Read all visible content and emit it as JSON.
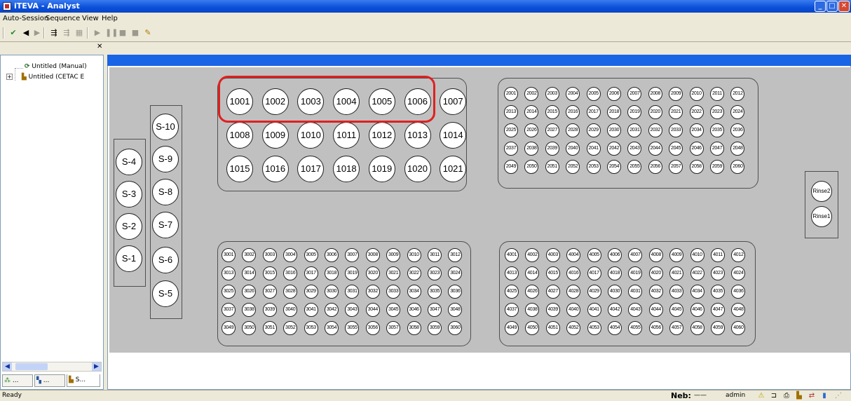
{
  "window": {
    "title": "iTEVA - Analyst"
  },
  "menu": [
    "Auto-Session",
    "Sequence",
    "View",
    "Help"
  ],
  "tree": {
    "items": [
      "Untitled (Manual)",
      "Untitled (CETAC E"
    ]
  },
  "left_tabs": [
    "...",
    "...",
    "S..."
  ],
  "standards_left": [
    "S-4",
    "S-3",
    "S-2",
    "S-1"
  ],
  "standards_right": [
    "S-10",
    "S-9",
    "S-8",
    "S-7",
    "S-6",
    "S-5"
  ],
  "rack1000": [
    [
      "1001",
      "1002",
      "1003",
      "1004",
      "1005",
      "1006",
      "1007"
    ],
    [
      "1008",
      "1009",
      "1010",
      "1011",
      "1012",
      "1013",
      "1014"
    ],
    [
      "1015",
      "1016",
      "1017",
      "1018",
      "1019",
      "1020",
      "1021"
    ]
  ],
  "rack2000": [
    [
      "2001",
      "2002",
      "2003",
      "2004",
      "2005",
      "2006",
      "2007",
      "2008",
      "2009",
      "2010",
      "2011",
      "2012"
    ],
    [
      "2013",
      "2014",
      "2015",
      "2016",
      "2017",
      "2018",
      "2019",
      "2020",
      "2021",
      "2022",
      "2023",
      "2024"
    ],
    [
      "2025",
      "2026",
      "2027",
      "2028",
      "2029",
      "2030",
      "2031",
      "2032",
      "2033",
      "2034",
      "2035",
      "2036"
    ],
    [
      "2037",
      "2038",
      "2039",
      "2040",
      "2041",
      "2042",
      "2043",
      "2044",
      "2045",
      "2046",
      "2047",
      "2048"
    ],
    [
      "2049",
      "2050",
      "2051",
      "2052",
      "2053",
      "2054",
      "2055",
      "2056",
      "2057",
      "2058",
      "2059",
      "2060"
    ]
  ],
  "rack3000": [
    [
      "3001",
      "3002",
      "3003",
      "3004",
      "3005",
      "3006",
      "3007",
      "3008",
      "3009",
      "3010",
      "3011",
      "3012"
    ],
    [
      "3013",
      "3014",
      "3015",
      "3016",
      "3017",
      "3018",
      "3019",
      "3020",
      "3021",
      "3022",
      "3023",
      "3024"
    ],
    [
      "3025",
      "3026",
      "3027",
      "3028",
      "3029",
      "3030",
      "3031",
      "3032",
      "3033",
      "3034",
      "3035",
      "3036"
    ],
    [
      "3037",
      "3038",
      "3039",
      "3040",
      "3041",
      "3042",
      "3043",
      "3044",
      "3045",
      "3046",
      "3047",
      "3048"
    ],
    [
      "3049",
      "3050",
      "3051",
      "3052",
      "3053",
      "3054",
      "3055",
      "3056",
      "3057",
      "3058",
      "3059",
      "3060"
    ]
  ],
  "rack4000": [
    [
      "4001",
      "4002",
      "4003",
      "4004",
      "4005",
      "4006",
      "4007",
      "4008",
      "4009",
      "4010",
      "4011",
      "4012"
    ],
    [
      "4013",
      "4014",
      "4015",
      "4016",
      "4017",
      "4018",
      "4019",
      "4020",
      "4021",
      "4022",
      "4023",
      "4024"
    ],
    [
      "4025",
      "4026",
      "4027",
      "4028",
      "4029",
      "4030",
      "4031",
      "4032",
      "4033",
      "4034",
      "4035",
      "4036"
    ],
    [
      "4037",
      "4038",
      "4039",
      "4040",
      "4041",
      "4042",
      "4043",
      "4044",
      "4045",
      "4046",
      "4047",
      "4048"
    ],
    [
      "4049",
      "4050",
      "4051",
      "4052",
      "4053",
      "4054",
      "4055",
      "4056",
      "4057",
      "4058",
      "4059",
      "4060"
    ]
  ],
  "rinse": [
    "Rinse2",
    "Rinse1"
  ],
  "status": {
    "left": "Ready",
    "neb_label": "Neb:",
    "neb_value": "——",
    "user": "admin"
  },
  "colors": {
    "highlight": "#e02020",
    "band": "#1a64e6",
    "tray": "#c0c0c0"
  }
}
